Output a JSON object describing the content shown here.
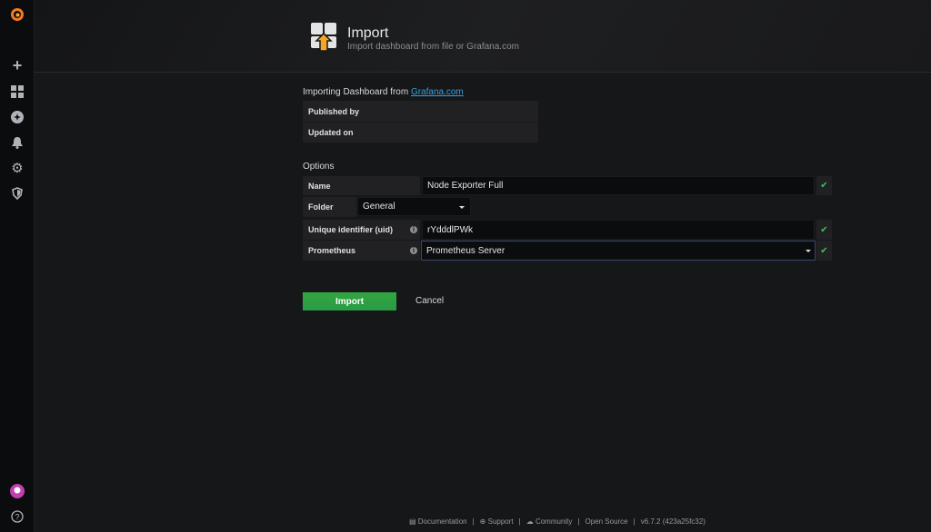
{
  "header": {
    "title": "Import",
    "subtitle": "Import dashboard from file or Grafana.com"
  },
  "source": {
    "prefix": "Importing Dashboard from",
    "link": "Grafana.com",
    "published_by_label": "Published by",
    "updated_on_label": "Updated on"
  },
  "options": {
    "title": "Options",
    "name_label": "Name",
    "name_value": "Node Exporter Full",
    "folder_label": "Folder",
    "folder_value": "General",
    "uid_label": "Unique identifier (uid)",
    "uid_value": "rYdddlPWk",
    "prometheus_label": "Prometheus",
    "prometheus_value": "Prometheus Server"
  },
  "actions": {
    "import": "Import",
    "cancel": "Cancel"
  },
  "footer": {
    "documentation": "Documentation",
    "support": "Support",
    "community": "Community",
    "open_source": "Open Source",
    "version": "v6.7.2 (423a25fc32)",
    "sep": "|"
  },
  "colors": {
    "accent": "#33a2e5",
    "success": "#299c46",
    "check": "#3ec256"
  }
}
